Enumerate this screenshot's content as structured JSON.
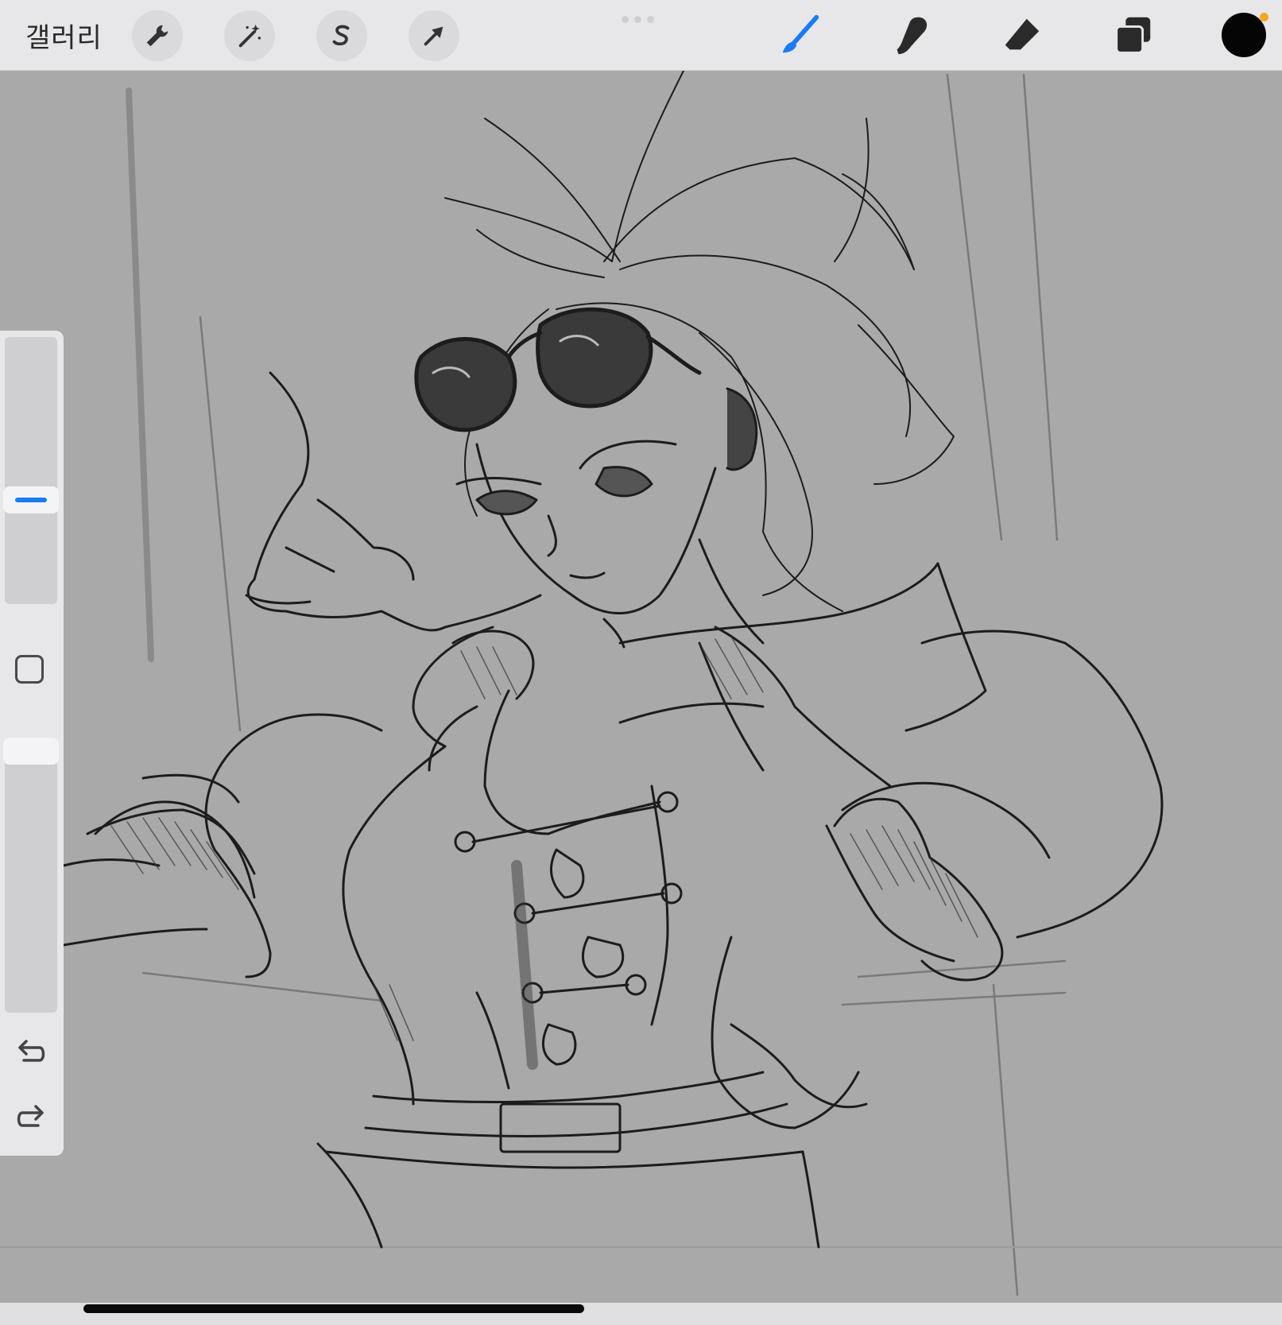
{
  "toolbar": {
    "gallery_label": "갤러리",
    "left_tools": [
      "wrench-icon",
      "magic-wand-icon",
      "selection-s-icon",
      "arrow-transform-icon"
    ],
    "right_tools": [
      "brush-icon",
      "smudge-icon",
      "eraser-icon",
      "layers-icon"
    ],
    "active_tool": "brush-icon",
    "accent_color": "#1a7cf5",
    "current_color": "#050505",
    "color_indicator": "#f5a623"
  },
  "sidebar": {
    "brush_size_level": 0.62,
    "opacity_level": 0.05,
    "icons": [
      "modify-square-icon",
      "undo-icon",
      "redo-icon"
    ]
  },
  "canvas": {
    "content": "sketch-artwork",
    "background": "#a9a9a9"
  }
}
